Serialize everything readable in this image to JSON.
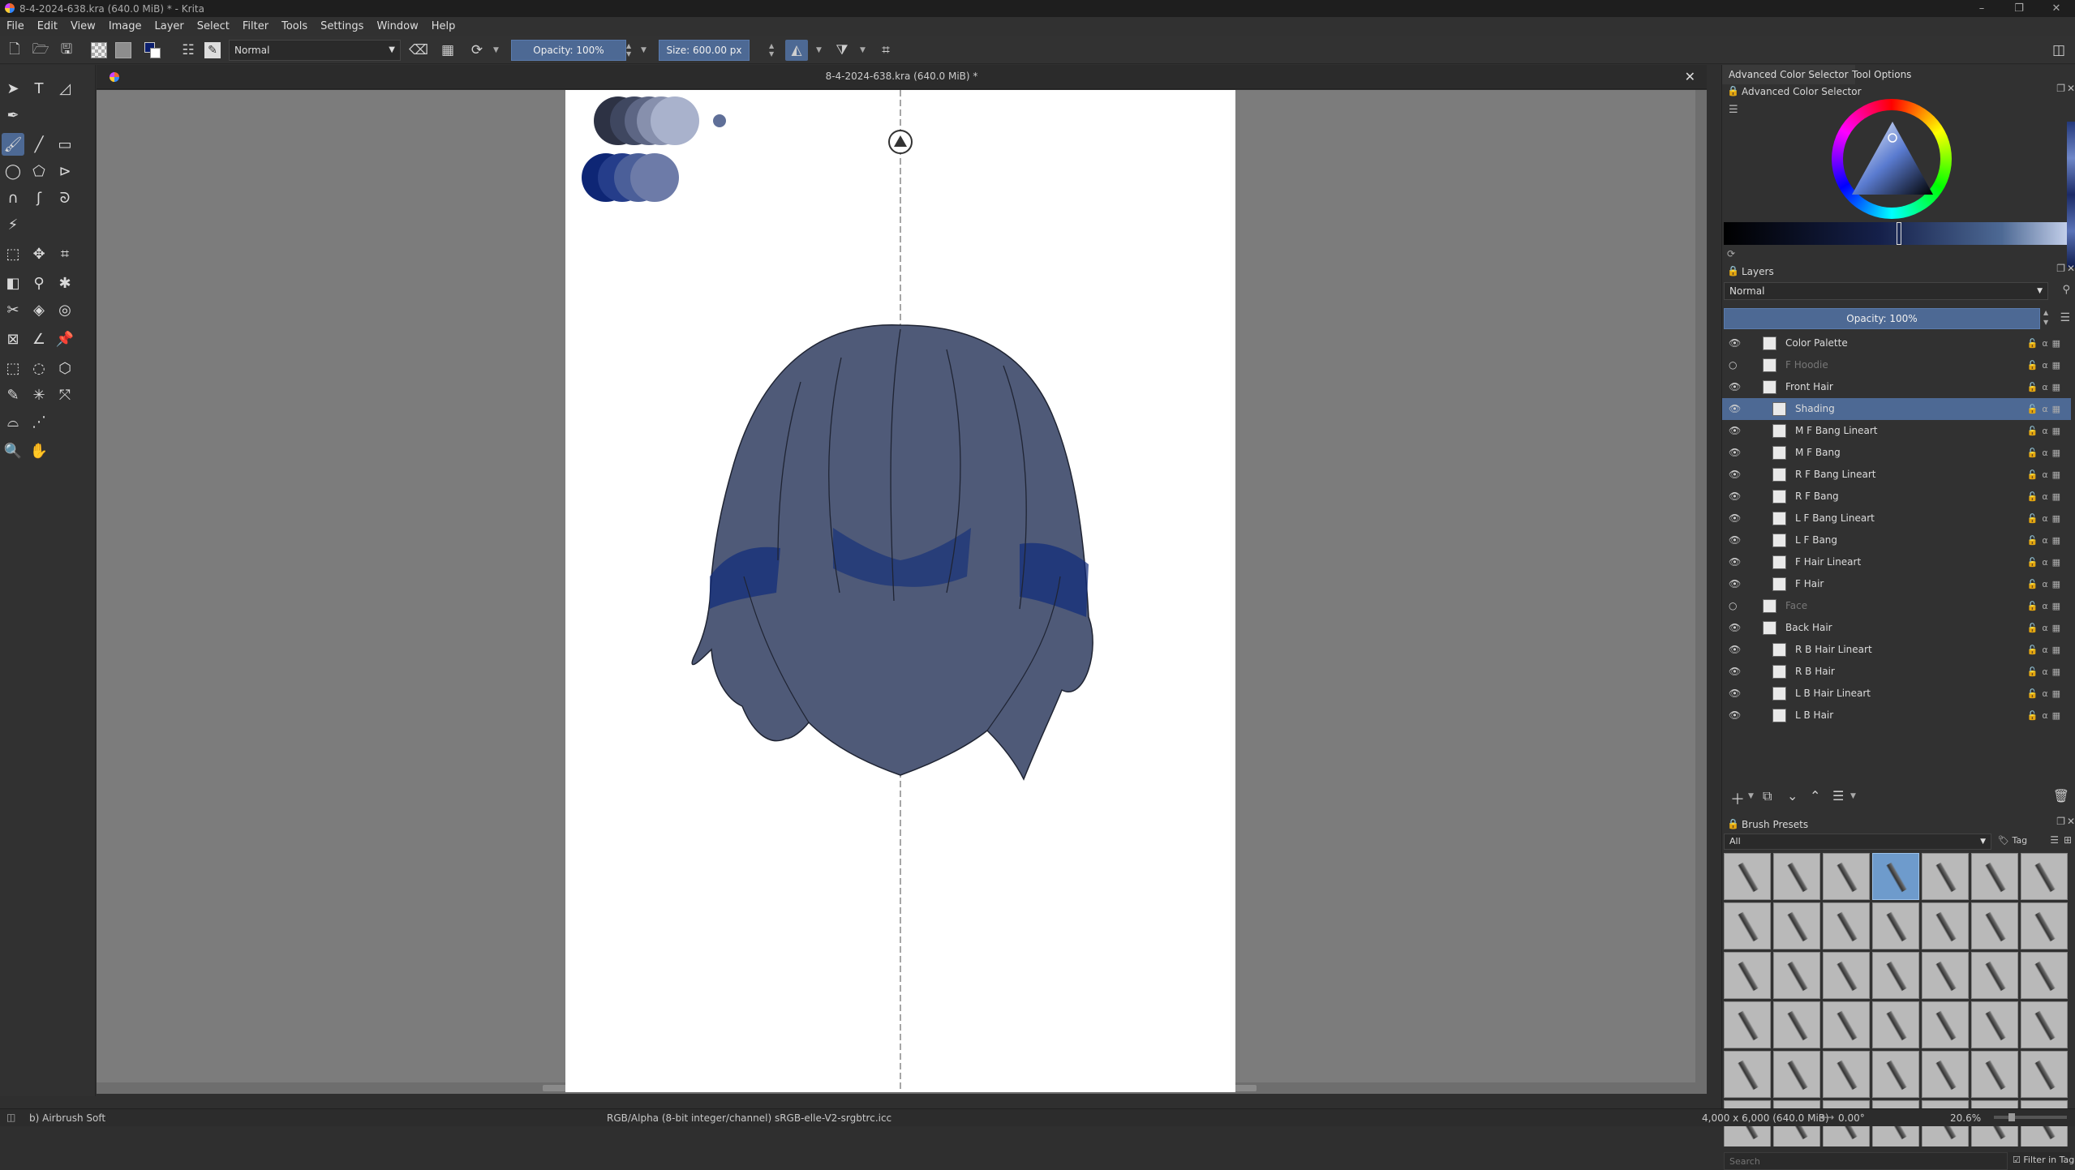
{
  "window": {
    "title": "8-4-2024-638.kra (640.0 MiB) * - Krita",
    "controls": [
      "–",
      "❐",
      "✕"
    ]
  },
  "menu": [
    "File",
    "Edit",
    "View",
    "Image",
    "Layer",
    "Select",
    "Filter",
    "Tools",
    "Settings",
    "Window",
    "Help"
  ],
  "toolbar": {
    "blend_mode": "Normal",
    "opacity": "Opacity: 100%",
    "size": "Size: 600.00 px"
  },
  "document": {
    "tab_title": "8-4-2024-638.kra (640.0 MiB) *",
    "close": "✕"
  },
  "color_selector": {
    "tab_label": "Advanced Color Selector",
    "tool_options_tab": "Tool Options",
    "header": "Advanced Color Selector"
  },
  "layers": {
    "header": "Layers",
    "blend_mode": "Normal",
    "opacity": "Opacity:  100%",
    "items": [
      {
        "name": "Color Palette",
        "indent": 0,
        "visible": true,
        "selected": false
      },
      {
        "name": "F Hoodie",
        "indent": 0,
        "visible": false,
        "selected": false
      },
      {
        "name": "Front Hair",
        "indent": 0,
        "visible": true,
        "selected": false
      },
      {
        "name": "Shading",
        "indent": 1,
        "visible": true,
        "selected": true
      },
      {
        "name": "M F Bang Lineart",
        "indent": 1,
        "visible": true,
        "selected": false
      },
      {
        "name": "M F Bang",
        "indent": 1,
        "visible": true,
        "selected": false
      },
      {
        "name": "R F Bang Lineart",
        "indent": 1,
        "visible": true,
        "selected": false
      },
      {
        "name": "R F Bang",
        "indent": 1,
        "visible": true,
        "selected": false
      },
      {
        "name": "L F Bang Lineart",
        "indent": 1,
        "visible": true,
        "selected": false
      },
      {
        "name": "L F Bang",
        "indent": 1,
        "visible": true,
        "selected": false
      },
      {
        "name": "F Hair Lineart",
        "indent": 1,
        "visible": true,
        "selected": false
      },
      {
        "name": "F Hair",
        "indent": 1,
        "visible": true,
        "selected": false
      },
      {
        "name": "Face",
        "indent": 0,
        "visible": false,
        "selected": false
      },
      {
        "name": "Back Hair",
        "indent": 0,
        "visible": true,
        "selected": false
      },
      {
        "name": "R B Hair Lineart",
        "indent": 1,
        "visible": true,
        "selected": false
      },
      {
        "name": "R B Hair",
        "indent": 1,
        "visible": true,
        "selected": false
      },
      {
        "name": "L B Hair Lineart",
        "indent": 1,
        "visible": true,
        "selected": false
      },
      {
        "name": "L B Hair",
        "indent": 1,
        "visible": true,
        "selected": false
      }
    ]
  },
  "brush_presets": {
    "header": "Brush Presets",
    "filter": "All",
    "tag": "Tag",
    "search_placeholder": "Search",
    "filter_in_tag": "Filter in Tag"
  },
  "status": {
    "brush": "b) Airbrush Soft",
    "color_space": "RGB/Alpha (8-bit integer/channel)  sRGB-elle-V2-srgbtrc.icc",
    "dimensions": "4,000 x 6,000 (640.0 MiB)",
    "rotation": "0.00°",
    "zoom": "20.6%"
  },
  "colors": {
    "accent": "#4d6994",
    "hair_fill": "#4f5a78",
    "hair_shade": "#0f2b7a",
    "canvas_bg": "#7c7c7c"
  }
}
